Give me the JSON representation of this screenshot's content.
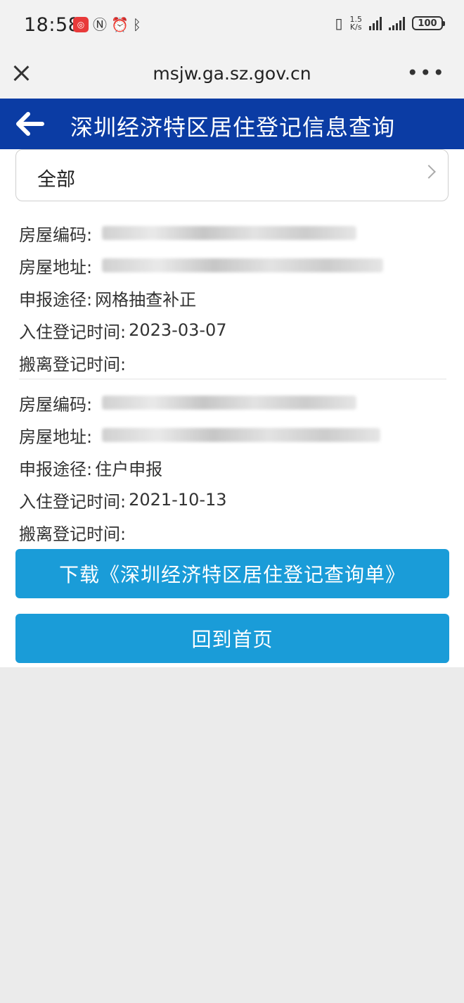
{
  "status_bar": {
    "time": "18:58",
    "net_speed_value": "1.5",
    "net_speed_unit": "K/s",
    "battery": "100"
  },
  "browser": {
    "url": "msjw.ga.sz.gov.cn"
  },
  "header": {
    "title": "深圳经济特区居住登记信息查询"
  },
  "filter": {
    "selected": "全部"
  },
  "records": [
    {
      "house_code_label": "房屋编码:",
      "address_label": "房屋地址:",
      "report_channel_label": "申报途径:",
      "report_channel_value": "网格抽查补正",
      "checkin_label": "入住登记时间:",
      "checkin_value": "2023-03-07",
      "checkout_label": "搬离登记时间:"
    },
    {
      "house_code_label": "房屋编码:",
      "address_label": "房屋地址:",
      "report_channel_label": "申报途径:",
      "report_channel_value": "住户申报",
      "checkin_label": "入住登记时间:",
      "checkin_value": "2021-10-13",
      "checkout_label": "搬离登记时间:"
    }
  ],
  "actions": {
    "download_label": "下载《深圳经济特区居住登记查询单》",
    "home_label": "回到首页"
  }
}
